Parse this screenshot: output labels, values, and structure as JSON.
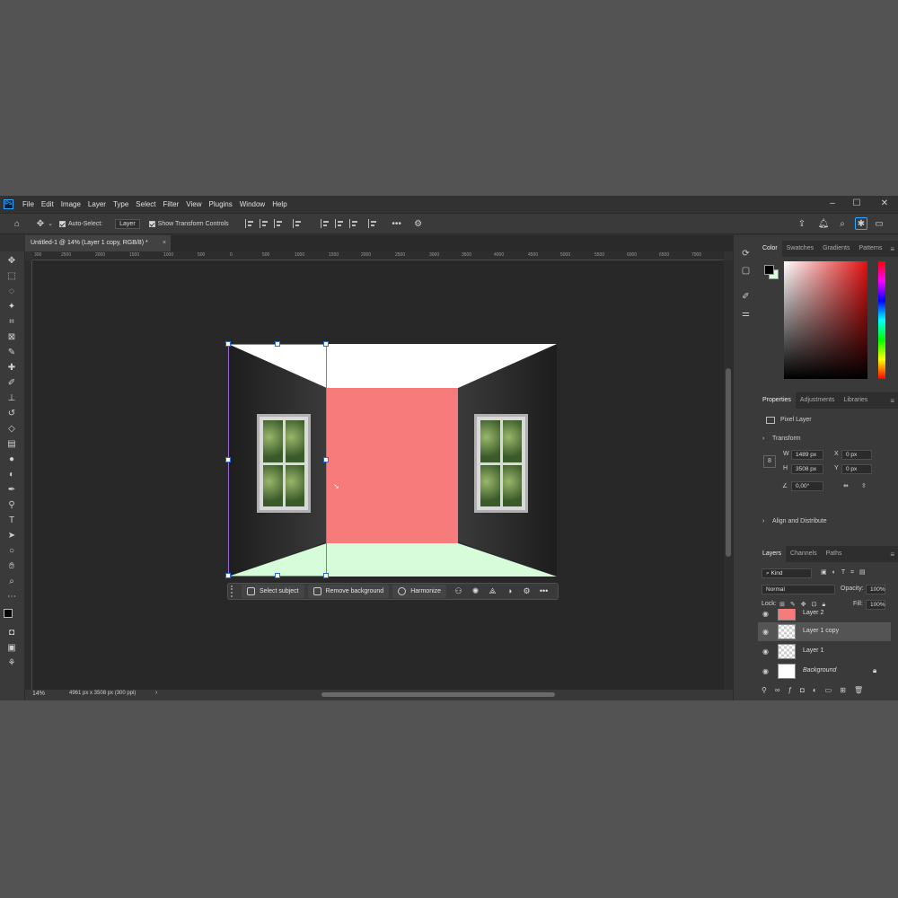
{
  "app": {
    "logo": "Ps",
    "menu": [
      "File",
      "Edit",
      "Image",
      "Layer",
      "Type",
      "Select",
      "Filter",
      "View",
      "Plugins",
      "Window",
      "Help"
    ],
    "window_controls": {
      "minimize": "–",
      "maximize": "☐",
      "close": "✕"
    }
  },
  "options_bar": {
    "auto_select_label": "Auto-Select:",
    "auto_select_value": "Layer",
    "show_transform_label": "Show Transform Controls",
    "more": "•••"
  },
  "document": {
    "tab_title": "Untitled-1 @ 14% (Layer 1 copy, RGB/8) *",
    "close": "×"
  },
  "ruler": {
    "ticks": [
      "300",
      "2500",
      "2000",
      "1500",
      "1000",
      "500",
      "0",
      "500",
      "1000",
      "1500",
      "2000",
      "2500",
      "3000",
      "3500",
      "4000",
      "4500",
      "5000",
      "5500",
      "6000",
      "6500",
      "7000"
    ]
  },
  "status": {
    "zoom": "14%",
    "doc_info": "4961 px x 3508 px (300 ppi)",
    "arrow": "›"
  },
  "context_bar": {
    "select_subject": "Select subject",
    "remove_background": "Remove background",
    "harmonize": "Harmonize",
    "more": "•••"
  },
  "color_panel": {
    "tabs": [
      "Color",
      "Swatches",
      "Gradients",
      "Patterns"
    ],
    "foreground": "#000000",
    "background": "#d6fcd9"
  },
  "properties_panel": {
    "tabs": [
      "Properties",
      "Adjustments",
      "Libraries"
    ],
    "layer_type": "Pixel Layer",
    "transform_label": "Transform",
    "w_label": "W",
    "w_value": "1489 px",
    "h_label": "H",
    "h_value": "3508 px",
    "x_label": "X",
    "x_value": "0 px",
    "y_label": "Y",
    "y_value": "0 px",
    "angle_value": "0,00°",
    "align_label": "Align and Distribute"
  },
  "layers_panel": {
    "tabs": [
      "Layers",
      "Channels",
      "Paths"
    ],
    "kind_label": "Kind",
    "blend_mode": "Normal",
    "opacity_label": "Opacity:",
    "opacity_value": "100%",
    "lock_label": "Lock:",
    "fill_label": "Fill:",
    "fill_value": "100%",
    "layers": [
      {
        "name": "Layer 2",
        "selected": false
      },
      {
        "name": "Layer 1 copy",
        "selected": true
      },
      {
        "name": "Layer 1",
        "selected": false
      },
      {
        "name": "Background",
        "selected": false
      }
    ]
  },
  "colors": {
    "back_wall": "#f77b7b",
    "floor": "#d6fcd9",
    "selection": "#9d6bd6"
  }
}
